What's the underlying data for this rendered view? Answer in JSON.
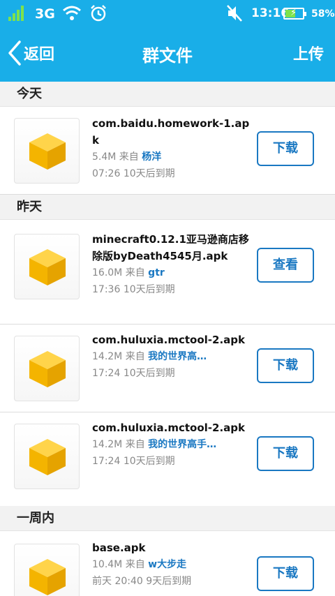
{
  "status_bar": {
    "network": "3G",
    "time": "13:16",
    "battery_percent": "58%",
    "battery_level": 0.58,
    "icons": [
      "signal-icon",
      "wifi-icon",
      "alarm-icon",
      "mute-icon",
      "battery-icon"
    ]
  },
  "header": {
    "back_label": "返回",
    "title": "群文件",
    "upload_label": "上传"
  },
  "sections": [
    {
      "label": "今天",
      "files": [
        {
          "name": "com.baidu.homework-1.apk",
          "size": "5.4M",
          "from_label": "来自",
          "sender": "杨洋",
          "time": "07:26",
          "expiry": "10天后到期",
          "action": "下载"
        }
      ]
    },
    {
      "label": "昨天",
      "files": [
        {
          "name": "minecraft0.12.1亚马逊商店移除版byDeath4545月.apk",
          "size": "16.0M",
          "from_label": "来自",
          "sender": "gtr",
          "time": "17:36",
          "expiry": "10天后到期",
          "action": "查看"
        },
        {
          "name": "com.huluxia.mctool-2.apk",
          "size": "14.2M",
          "from_label": "来自",
          "sender": "我的世界高…",
          "time": "17:24",
          "expiry": "10天后到期",
          "action": "下载"
        },
        {
          "name": "com.huluxia.mctool-2.apk",
          "size": "14.2M",
          "from_label": "来自",
          "sender": "我的世界高手…",
          "time": "17:24",
          "expiry": "10天后到期",
          "action": "下载"
        }
      ]
    },
    {
      "label": "一周内",
      "files": [
        {
          "name": "base.apk",
          "size": "10.4M",
          "from_label": "来自",
          "sender": "w大步走",
          "time": "前天 20:40",
          "expiry": "9天后到期",
          "action": "下载"
        }
      ]
    }
  ],
  "colors": {
    "header": "#19aee8",
    "accent": "#1a78c2",
    "file_icon": "#f4b400"
  }
}
